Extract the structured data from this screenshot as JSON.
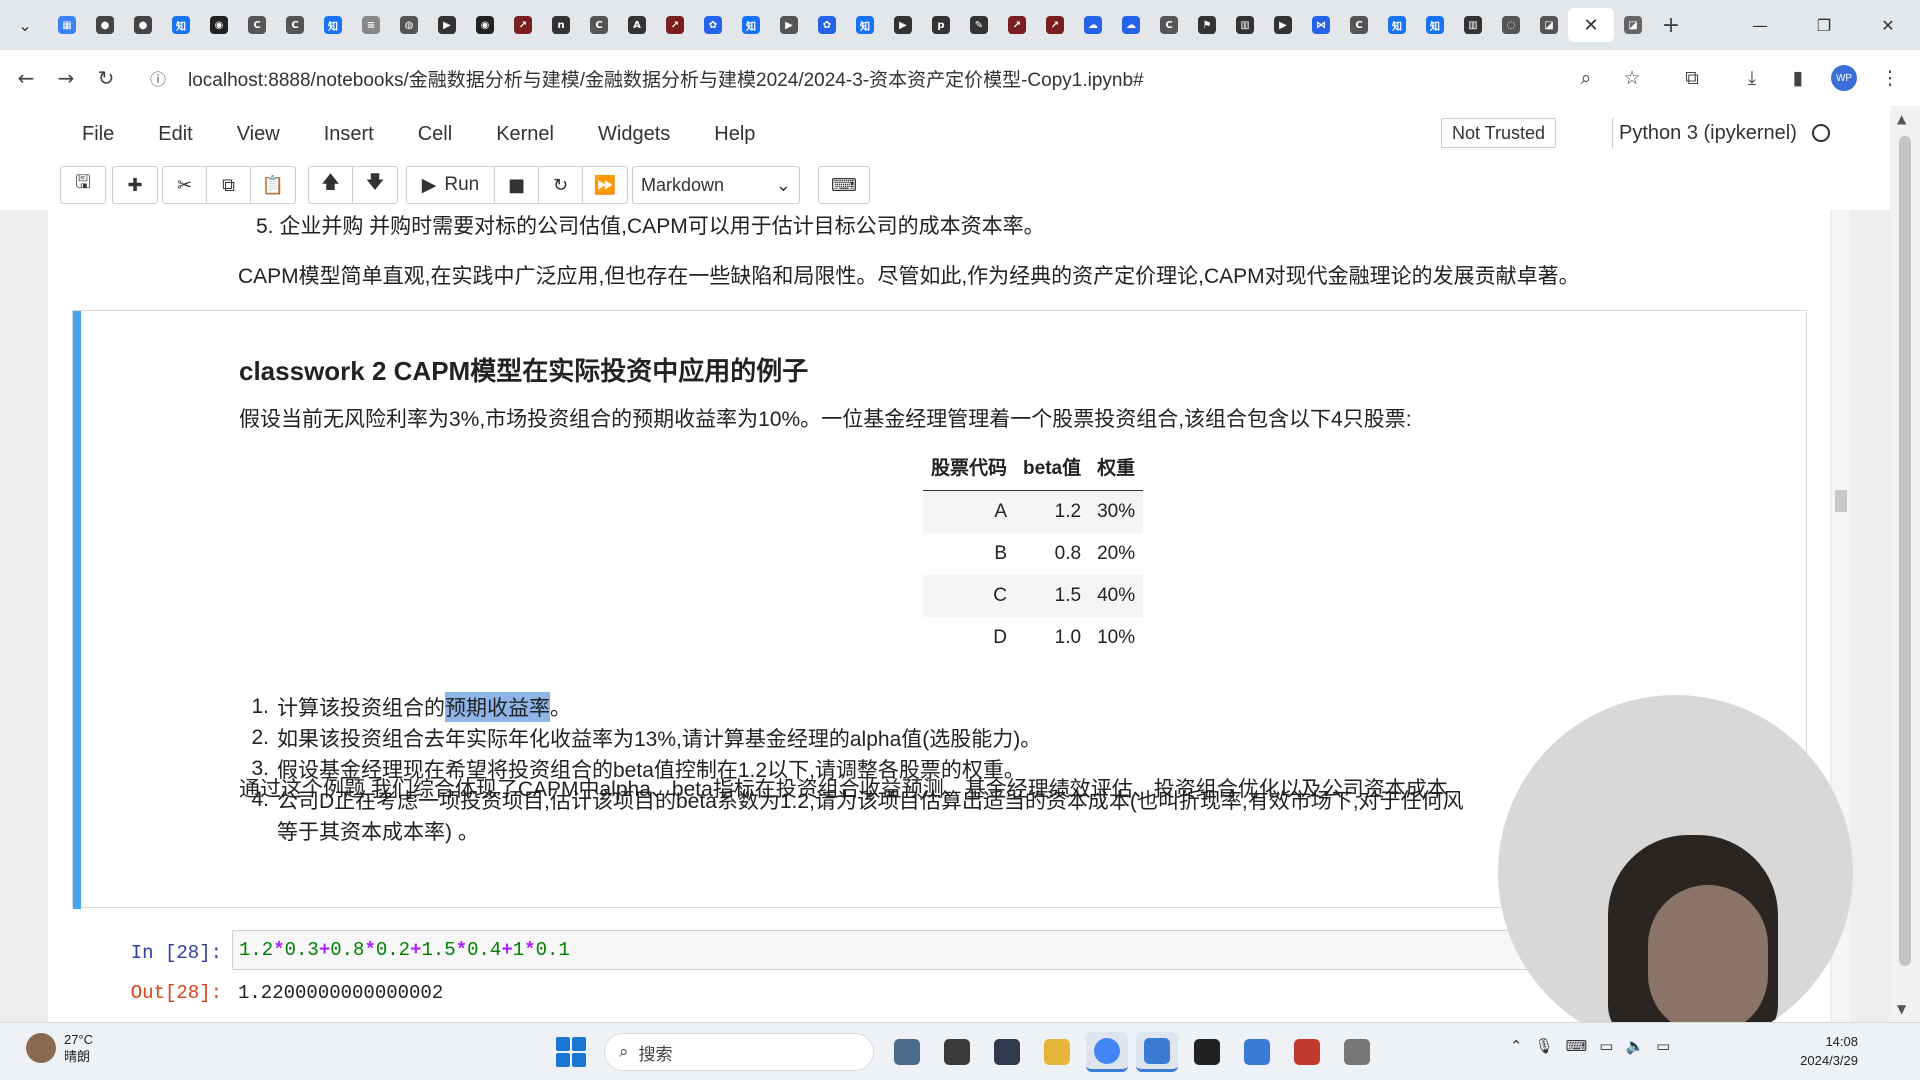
{
  "browser": {
    "tabs": [
      {
        "icon": "calendar-icon",
        "color": "#3b82f6",
        "glyph": "▦"
      },
      {
        "icon": "record-icon",
        "color": "#444444",
        "glyph": "●"
      },
      {
        "icon": "record-icon",
        "color": "#444444",
        "glyph": "●"
      },
      {
        "icon": "zhihu-icon",
        "color": "#1772f6",
        "glyph": "知"
      },
      {
        "icon": "github-icon",
        "color": "#222222",
        "glyph": "◉"
      },
      {
        "icon": "c-icon",
        "color": "#555555",
        "glyph": "C"
      },
      {
        "icon": "c-icon",
        "color": "#555555",
        "glyph": "C"
      },
      {
        "icon": "zhihu-icon",
        "color": "#1772f6",
        "glyph": "知"
      },
      {
        "icon": "doc-icon",
        "color": "#888888",
        "glyph": "≡"
      },
      {
        "icon": "globe-icon",
        "color": "#555555",
        "glyph": "◍"
      },
      {
        "icon": "video-icon",
        "color": "#333333",
        "glyph": "▶"
      },
      {
        "icon": "github-icon",
        "color": "#222222",
        "glyph": "◉"
      },
      {
        "icon": "arrow-icon",
        "color": "#7a1f1f",
        "glyph": "↗"
      },
      {
        "icon": "n-icon",
        "color": "#333333",
        "glyph": "n"
      },
      {
        "icon": "c-icon",
        "color": "#555555",
        "glyph": "C"
      },
      {
        "icon": "a-icon",
        "color": "#333333",
        "glyph": "A"
      },
      {
        "icon": "arrow-icon",
        "color": "#7a1f1f",
        "glyph": "↗"
      },
      {
        "icon": "paw-icon",
        "color": "#2563eb",
        "glyph": "✿"
      },
      {
        "icon": "zhihu-icon",
        "color": "#1772f6",
        "glyph": "知"
      },
      {
        "icon": "video-icon",
        "color": "#555555",
        "glyph": "▶"
      },
      {
        "icon": "paw-icon",
        "color": "#2563eb",
        "glyph": "✿"
      },
      {
        "icon": "zhihu-icon",
        "color": "#1772f6",
        "glyph": "知"
      },
      {
        "icon": "video-icon",
        "color": "#333333",
        "glyph": "▶"
      },
      {
        "icon": "pds-icon",
        "color": "#333333",
        "glyph": "p"
      },
      {
        "icon": "pen-icon",
        "color": "#333333",
        "glyph": "✎"
      },
      {
        "icon": "arrow-icon",
        "color": "#7a1f1f",
        "glyph": "↗"
      },
      {
        "icon": "arrow-icon",
        "color": "#7a1f1f",
        "glyph": "↗"
      },
      {
        "icon": "cloud-icon",
        "color": "#2563eb",
        "glyph": "☁"
      },
      {
        "icon": "cloud-icon",
        "color": "#2563eb",
        "glyph": "☁"
      },
      {
        "icon": "c-icon",
        "color": "#555555",
        "glyph": "C"
      },
      {
        "icon": "runner-icon",
        "color": "#333333",
        "glyph": "⚑"
      },
      {
        "icon": "book-icon",
        "color": "#333333",
        "glyph": "▥"
      },
      {
        "icon": "video-icon",
        "color": "#333333",
        "glyph": "▶"
      },
      {
        "icon": "vs-icon",
        "color": "#2563eb",
        "glyph": "⋈"
      },
      {
        "icon": "c-icon",
        "color": "#555555",
        "glyph": "C"
      },
      {
        "icon": "zhihu-icon",
        "color": "#1772f6",
        "glyph": "知"
      },
      {
        "icon": "zhihu-icon",
        "color": "#1772f6",
        "glyph": "知"
      },
      {
        "icon": "book-icon",
        "color": "#333333",
        "glyph": "▥"
      },
      {
        "icon": "loading-icon",
        "color": "#555555",
        "glyph": "◌"
      },
      {
        "icon": "eraser-icon",
        "color": "#555555",
        "glyph": "◪"
      }
    ],
    "new_tab_icon": "plus-icon",
    "url": "localhost:8888/notebooks/金融数据分析与建模/金融数据分析与建模2024/2024-3-资本资产定价模型-Copy1.ipynb#",
    "profile_initials": "WP"
  },
  "jupyter": {
    "menu": [
      "File",
      "Edit",
      "View",
      "Insert",
      "Cell",
      "Kernel",
      "Widgets",
      "Help"
    ],
    "trust": "Not Trusted",
    "kernel": "Python 3 (ipykernel)",
    "run_label": "Run",
    "cell_type": "Markdown"
  },
  "notebook": {
    "prev_item": "5. 企业并购 并购时需要对标的公司估值,CAPM可以用于估计目标公司的成本资本率。",
    "prev_summary": "CAPM模型简单直观,在实践中广泛应用,但也存在一些缺陷和局限性。尽管如此,作为经典的资产定价理论,CAPM对现代金融理论的发展贡献卓著。",
    "classwork_title": "classwork 2 CAPM模型在实际投资中应用的例子",
    "intro": "假设当前无风险利率为3%,市场投资组合的预期收益率为10%。一位基金经理管理着一个股票投资组合,该组合包含以下4只股票:",
    "table": {
      "headers": [
        "股票代码",
        "beta值",
        "权重"
      ],
      "rows": [
        [
          "A",
          "1.2",
          "30%"
        ],
        [
          "B",
          "0.8",
          "20%"
        ],
        [
          "C",
          "1.5",
          "40%"
        ],
        [
          "D",
          "1.0",
          "10%"
        ]
      ]
    },
    "tasks": [
      {
        "num": "1.",
        "pre": "计算该投资组合的",
        "highlight": "预期收益率",
        "post": "。"
      },
      {
        "num": "2.",
        "text": "如果该投资组合去年实际年化收益率为13%,请计算基金经理的alpha值(选股能力)。"
      },
      {
        "num": "3.",
        "text": "假设基金经理现在希望将投资组合的beta值控制在1.2以下,请调整各股票的权重。"
      },
      {
        "num": "4.",
        "text": "公司D正在考虑一项投资项目,估计该项目的beta系数为1.2,请为该项目估算出适当的资本成本(也叫折现率,有效市场下,对于任何风",
        "cont": "等于其资本成本率) 。"
      }
    ],
    "summary": "通过这个例题,我们综合体现了CAPM中alpha、beta指标在投资组合收益预测、基金经理绩效评估、投资组合优化以及公司资本成本",
    "code_cell": {
      "in_prompt": "In  [28]:",
      "out_prompt": "Out[28]:",
      "output": "1.2200000000000002"
    }
  },
  "taskbar": {
    "weather_temp": "27°C",
    "weather_desc": "晴朗",
    "search_placeholder": "搜索",
    "time": "14:08",
    "date": "2024/3/29",
    "apps": [
      {
        "name": "fish-app-icon",
        "color": "#4a6b8a"
      },
      {
        "name": "file-app-icon",
        "color": "#3a3a3a"
      },
      {
        "name": "folder-dark-app-icon",
        "color": "#2f3b4c"
      },
      {
        "name": "folder-app-icon",
        "color": "#e6b53a"
      },
      {
        "name": "chrome-app-icon",
        "color": "#4285f4"
      },
      {
        "name": "pointer-app-icon",
        "color": "#3a7bd5"
      },
      {
        "name": "terminal-app-icon",
        "color": "#222222"
      },
      {
        "name": "check-app-icon",
        "color": "#3a7bd5"
      },
      {
        "name": "wps-app-icon",
        "color": "#c0392b"
      },
      {
        "name": "bug-app-icon",
        "color": "#777777"
      }
    ]
  }
}
